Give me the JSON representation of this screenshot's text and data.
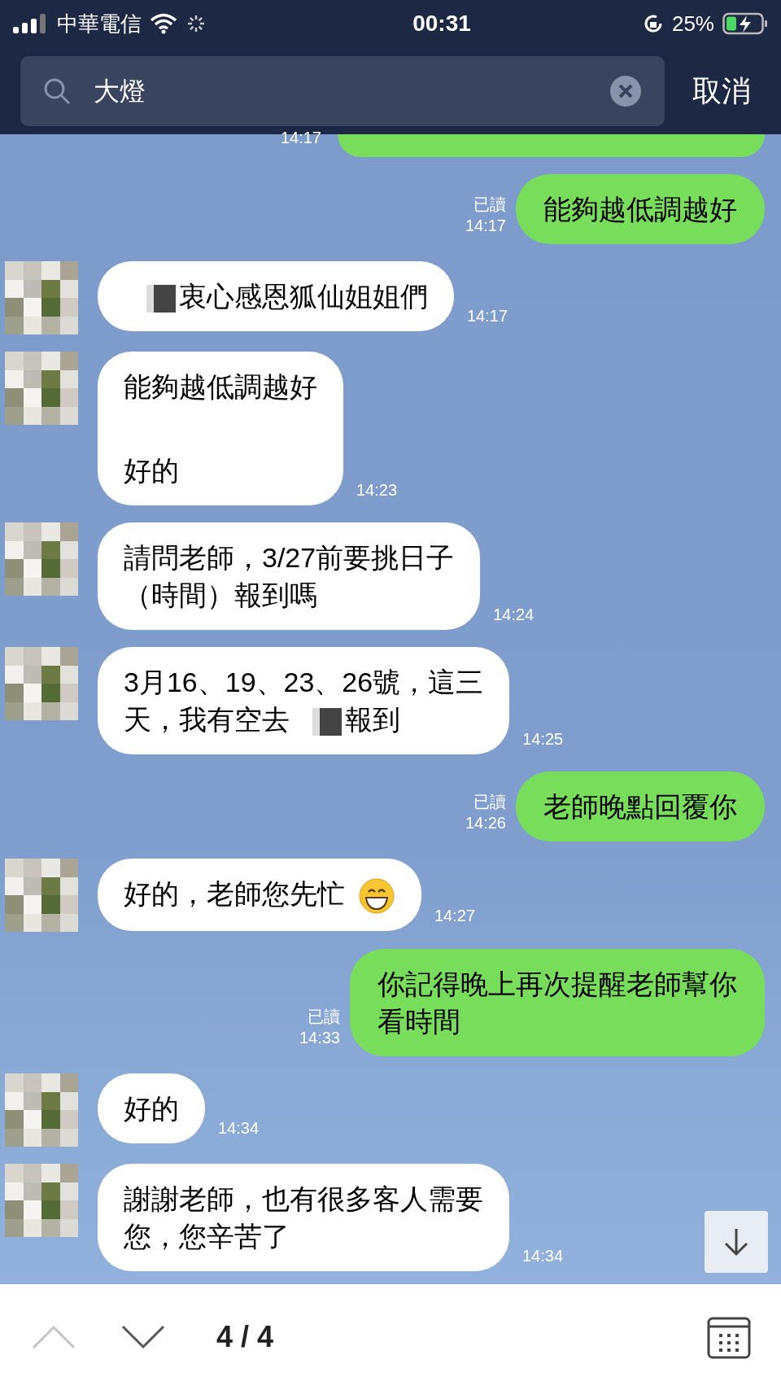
{
  "status_bar": {
    "carrier": "中華電信",
    "time": "00:31",
    "battery": "25%"
  },
  "search": {
    "value": "大燈",
    "cancel": "取消"
  },
  "top_partial": {
    "time": "14:17"
  },
  "messages": [
    {
      "kind": "sent",
      "read": "已讀",
      "time": "14:17",
      "lines": [
        [
          {
            "text": "能夠越低調越好"
          }
        ]
      ]
    },
    {
      "kind": "received",
      "time": "14:17",
      "lines": [
        [
          {
            "kind": "redacted"
          },
          {
            "text": "衷心感恩狐仙姐姐們"
          }
        ]
      ]
    },
    {
      "kind": "received",
      "time": "14:23",
      "lines": [
        [
          {
            "text": "能夠越低調越好"
          }
        ],
        [
          {
            "kind": "blank"
          }
        ],
        [
          {
            "text": "好的"
          }
        ]
      ]
    },
    {
      "kind": "received",
      "time": "14:24",
      "lines": [
        [
          {
            "text": "請問老師，3/27前要挑日子"
          }
        ],
        [
          {
            "text": "（時間）報到嗎"
          }
        ]
      ]
    },
    {
      "kind": "received",
      "time": "14:25",
      "lines": [
        [
          {
            "text": "3月16、19、23、26號，這三"
          }
        ],
        [
          {
            "text": "天，我有空去"
          },
          {
            "kind": "redacted"
          },
          {
            "text": "報到"
          }
        ]
      ]
    },
    {
      "kind": "sent",
      "read": "已讀",
      "time": "14:26",
      "lines": [
        [
          {
            "text": "老師晚點回覆你"
          }
        ]
      ]
    },
    {
      "kind": "received",
      "time": "14:27",
      "lines": [
        [
          {
            "text": "好的，老師您先忙"
          },
          {
            "kind": "grin"
          }
        ]
      ]
    },
    {
      "kind": "sent",
      "read": "已讀",
      "time": "14:33",
      "lines": [
        [
          {
            "text": "你記得晚上再次提醒老師幫你"
          }
        ],
        [
          {
            "text": "看時間"
          }
        ]
      ]
    },
    {
      "kind": "received",
      "time": "14:34",
      "lines": [
        [
          {
            "text": "好的"
          }
        ]
      ]
    },
    {
      "kind": "received",
      "time": "14:34",
      "lines": [
        [
          {
            "text": "謝謝老師，也有很多客人需要"
          }
        ],
        [
          {
            "text": "您，您辛苦了"
          }
        ]
      ]
    }
  ],
  "result_nav": {
    "counter": "4 / 4",
    "previous_disabled": true,
    "next_disabled": false
  }
}
